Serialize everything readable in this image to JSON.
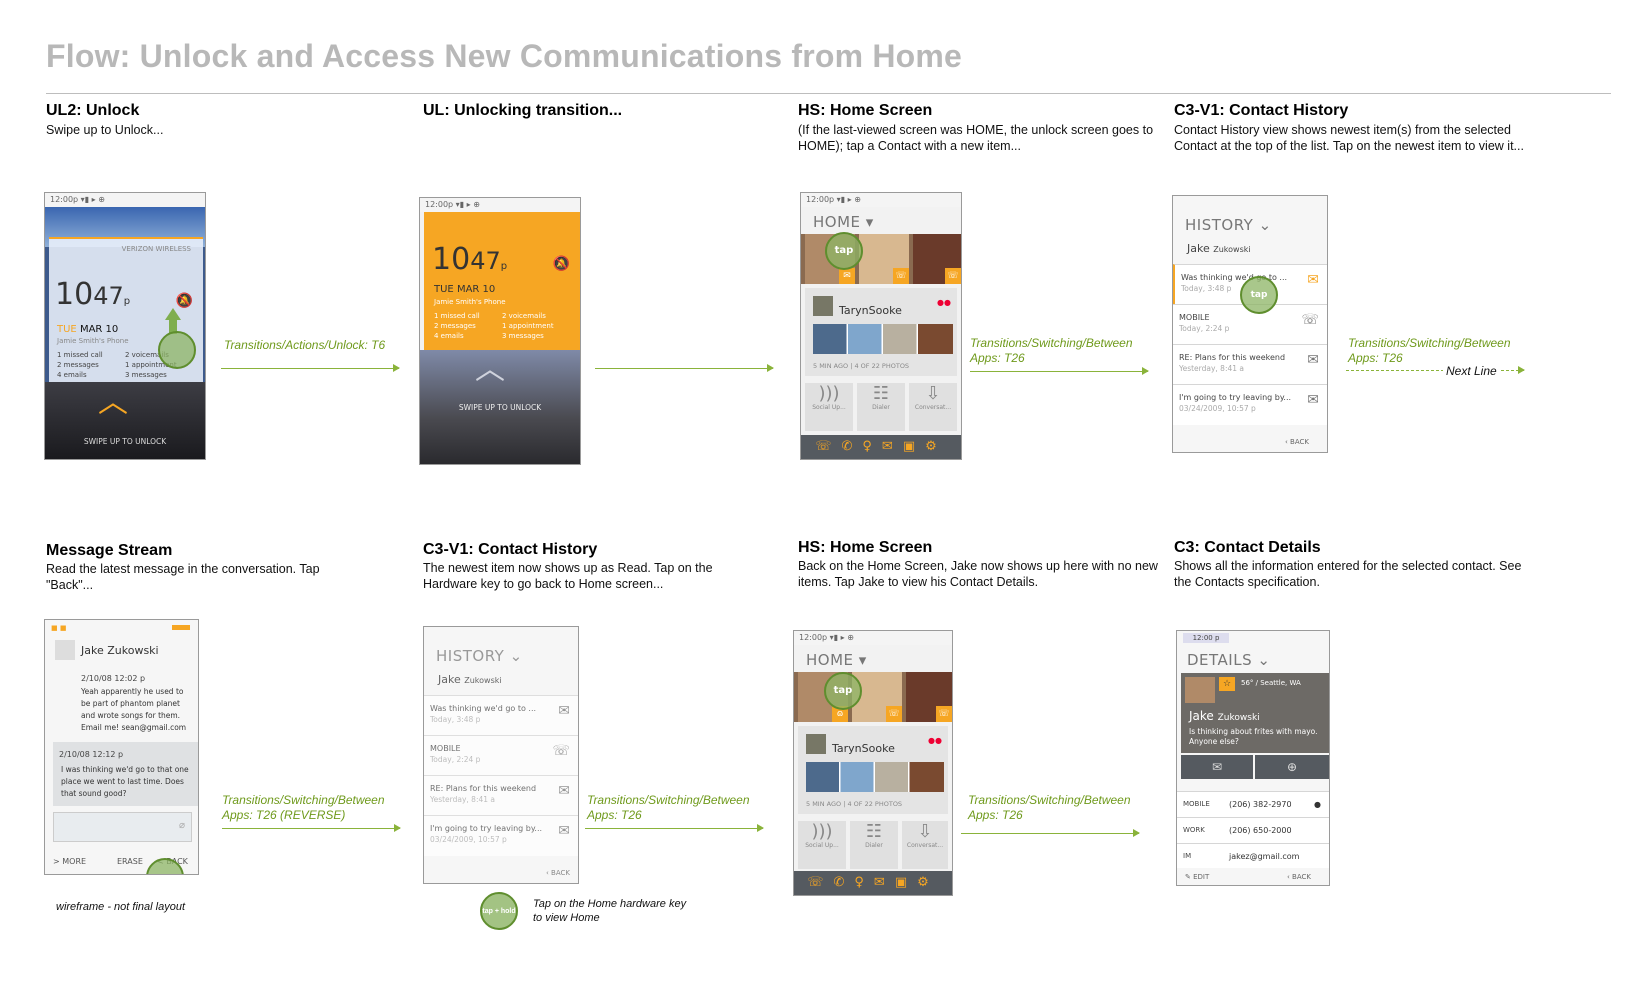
{
  "title": "Flow:  Unlock and Access New Communications from Home",
  "steps": {
    "s1": {
      "head": "UL2: Unlock",
      "desc": "Swipe up to Unlock..."
    },
    "s2": {
      "head": "UL: Unlocking transition...",
      "desc": ""
    },
    "s3": {
      "head": "HS: Home Screen",
      "desc": "(If the last-viewed screen was HOME, the unlock screen goes to HOME);  tap a Contact with a new item..."
    },
    "s4": {
      "head": "C3-V1: Contact History",
      "desc": "Contact History view shows newest item(s) from the selected Contact  at the top of the list.  Tap on the newest item to view it..."
    },
    "s5": {
      "head": "Message Stream",
      "desc": "Read the latest message in the conversation. Tap \"Back\"..."
    },
    "s6": {
      "head": "C3-V1: Contact History",
      "desc": "The newest item now shows up as Read. Tap on the Hardware key to go back to Home screen..."
    },
    "s7": {
      "head": "HS: Home Screen",
      "desc": "Back on the Home Screen, Jake now shows up here with no new items. Tap Jake to view his Contact Details."
    },
    "s8": {
      "head": "C3: Contact Details",
      "desc": "Shows all the information entered for the selected contact. See the Contacts specification."
    }
  },
  "transitions": {
    "t1": "Transitions/Actions/Unlock: T6",
    "t3": "Transitions/Switching/Between Apps: T26",
    "t4": "Transitions/Switching/Between Apps: T26",
    "next_line": "Next Line",
    "t5": "Transitions/Switching/Between Apps: T26  (REVERSE)",
    "t6": "Transitions/Switching/Between Apps: T26",
    "t7": "Transitions/Switching/Between Apps: T26"
  },
  "notes": {
    "wireframe": "wireframe - not final layout",
    "home_key": "Tap on the Home hardware key to view Home",
    "tap_hold": "tap + hold"
  },
  "phone": {
    "time": "12:00p",
    "time2": "12:00 p",
    "carrier": "VERIZON WIRELESS",
    "clock_big": "10",
    "clock_min": "47",
    "clock_ampm": "p",
    "day": "TUE",
    "date": "MAR 10",
    "owner": "Jamie Smith's Phone",
    "stats": [
      "1 missed call",
      "2 voicemails",
      "2 messages",
      "1 appointment",
      "4 emails",
      "3 messages"
    ],
    "swipe": "SWIPE UP TO UNLOCK",
    "tap": "tap",
    "home": "HOME",
    "contact_name": "TarynSooke",
    "photo_meta": "5 MIN AGO  |  4 OF 22 PHOTOS",
    "apps": [
      "Social Up...",
      "Dialer",
      "Conversat..."
    ],
    "history": "HISTORY",
    "jake_first": "Jake",
    "jake_last": "Zukowski",
    "hist_rows": [
      {
        "l1": "Was thinking we'd go to ...",
        "l2": "Today, 3:48 p"
      },
      {
        "l1": "MOBILE",
        "l2": "Today, 2:24 p"
      },
      {
        "l1": "RE: Plans for this weekend",
        "l2": "Yesterday, 8:41 a"
      },
      {
        "l1": "I'm going to try leaving by...",
        "l2": "03/24/2009, 10:57 p"
      }
    ],
    "back": "BACK",
    "msg_name": "Jake Zukowski",
    "msg1_time": "2/10/08  12:02 p",
    "msg1_text": "Yeah apparently he used to be part of phantom planet and wrote songs for them. Email me! sean@gmail.com",
    "msg2_time": "2/10/08  12:12 p",
    "msg2_text": "I was thinking we'd go to that one place we went to last time. Does that sound good?",
    "more": "MORE",
    "erase": "ERASE",
    "details": "DETAILS",
    "weather": "56° / Seattle, WA",
    "status_msg": "Is thinking about frites with mayo. Anyone else?",
    "detail_rows": [
      {
        "label": "MOBILE",
        "value": "(206) 382-2970"
      },
      {
        "label": "WORK",
        "value": "(206) 650-2000"
      },
      {
        "label": "IM",
        "value": "jakez@gmail.com"
      }
    ],
    "edit": "EDIT"
  }
}
